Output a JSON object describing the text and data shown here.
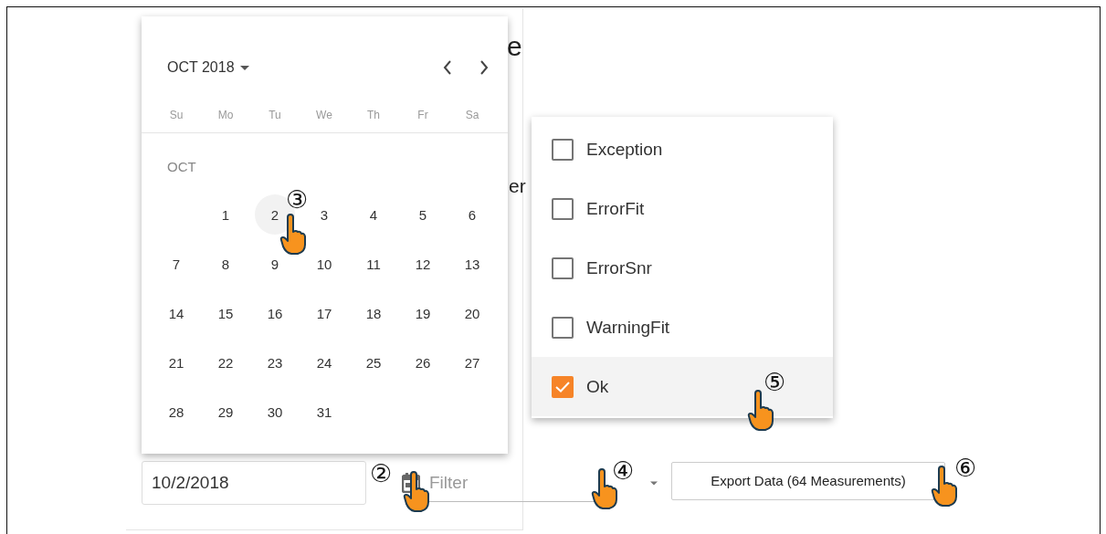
{
  "background_fragments": [
    "e",
    "er"
  ],
  "calendar": {
    "month_label": "OCT 2018",
    "weekdays": [
      "Su",
      "Mo",
      "Tu",
      "We",
      "Th",
      "Fr",
      "Sa"
    ],
    "section_label": "OCT",
    "weeks": [
      {
        "kind": "first",
        "days": [
          {
            "label": "1",
            "highlighted": false
          },
          {
            "label": "2",
            "highlighted": true
          },
          {
            "label": "3",
            "highlighted": false
          },
          {
            "label": "4",
            "highlighted": false
          },
          {
            "label": "5",
            "highlighted": false
          },
          {
            "label": "6",
            "highlighted": false
          }
        ]
      },
      {
        "kind": "full",
        "days": [
          {
            "label": "7",
            "highlighted": false
          },
          {
            "label": "8",
            "highlighted": false
          },
          {
            "label": "9",
            "highlighted": false
          },
          {
            "label": "10",
            "highlighted": false
          },
          {
            "label": "11",
            "highlighted": false
          },
          {
            "label": "12",
            "highlighted": false
          },
          {
            "label": "13",
            "highlighted": false
          }
        ]
      },
      {
        "kind": "full",
        "days": [
          {
            "label": "14",
            "highlighted": false
          },
          {
            "label": "15",
            "highlighted": false
          },
          {
            "label": "16",
            "highlighted": false
          },
          {
            "label": "17",
            "highlighted": false
          },
          {
            "label": "18",
            "highlighted": false
          },
          {
            "label": "19",
            "highlighted": false
          },
          {
            "label": "20",
            "highlighted": false
          }
        ]
      },
      {
        "kind": "full",
        "days": [
          {
            "label": "21",
            "highlighted": false
          },
          {
            "label": "22",
            "highlighted": false
          },
          {
            "label": "23",
            "highlighted": false
          },
          {
            "label": "24",
            "highlighted": false
          },
          {
            "label": "25",
            "highlighted": false
          },
          {
            "label": "26",
            "highlighted": false
          },
          {
            "label": "27",
            "highlighted": false
          }
        ]
      },
      {
        "kind": "last",
        "days": [
          {
            "label": "28",
            "highlighted": false
          },
          {
            "label": "29",
            "highlighted": false
          },
          {
            "label": "30",
            "highlighted": false
          },
          {
            "label": "31",
            "highlighted": false
          }
        ]
      }
    ]
  },
  "filter_menu": {
    "options": [
      {
        "label": "Exception",
        "checked": false,
        "highlighted": false
      },
      {
        "label": "ErrorFit",
        "checked": false,
        "highlighted": false
      },
      {
        "label": "ErrorSnr",
        "checked": false,
        "highlighted": false
      },
      {
        "label": "WarningFit",
        "checked": false,
        "highlighted": false
      },
      {
        "label": "Ok",
        "checked": true,
        "highlighted": true
      }
    ]
  },
  "date_field": {
    "value": "10/2/2018"
  },
  "filter_field": {
    "placeholder": "Filter"
  },
  "export_button": {
    "label": "Export Data (64 Measurements)"
  },
  "callouts": [
    {
      "label": "②"
    },
    {
      "label": "③"
    },
    {
      "label": "④"
    },
    {
      "label": "⑤"
    },
    {
      "label": "⑥"
    }
  ]
}
